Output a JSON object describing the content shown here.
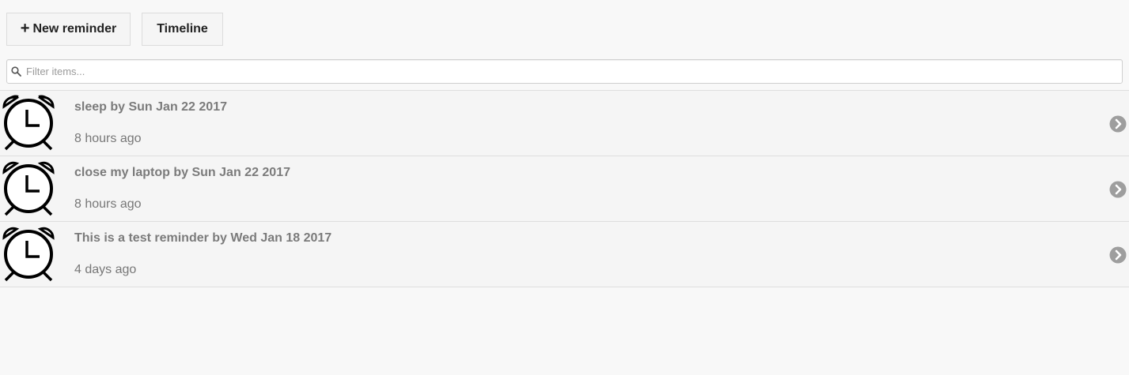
{
  "toolbar": {
    "new_reminder_label": "New reminder",
    "new_reminder_icon": "plus-icon",
    "timeline_label": "Timeline"
  },
  "filter": {
    "placeholder": "Filter items...",
    "value": "",
    "icon": "search-icon"
  },
  "reminders": [
    {
      "title": "sleep by Sun Jan 22 2017",
      "time": "8 hours ago",
      "icon": "alarm-clock-icon"
    },
    {
      "title": "close my laptop by Sun Jan 22 2017",
      "time": "8 hours ago",
      "icon": "alarm-clock-icon"
    },
    {
      "title": "This is a test reminder by Wed Jan 18 2017",
      "time": "4 days ago",
      "icon": "alarm-clock-icon"
    }
  ],
  "colors": {
    "background": "#f8f8f8",
    "row_background": "#f5f5f5",
    "title_text": "#7b7b7b",
    "chevron": "#9e9e9e"
  }
}
